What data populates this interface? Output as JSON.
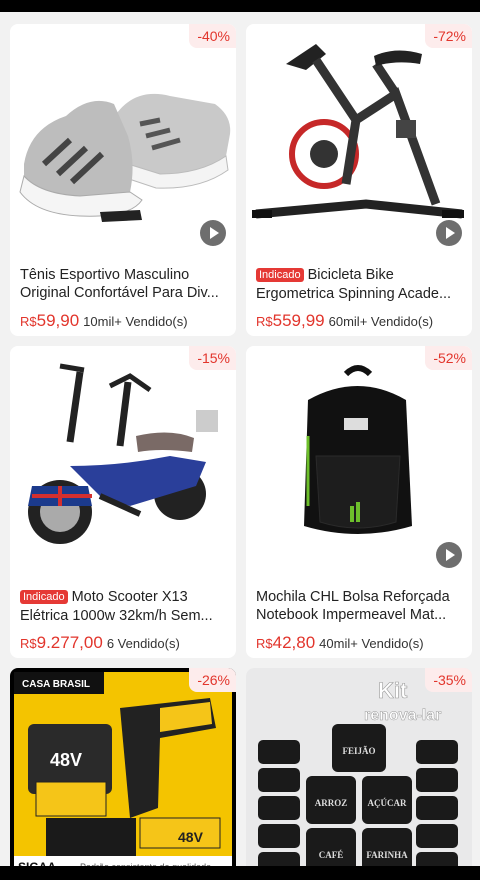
{
  "products": [
    {
      "title": "Tênis Esportivo Masculino Original Confortável Para Div...",
      "currency": "R$",
      "price": "59,90",
      "sold": "10mil+ Vendido(s)",
      "discount": "-40%",
      "tag": "",
      "video": true
    },
    {
      "title": "Bicicleta Bike Ergometrica Spinning Acade...",
      "currency": "R$",
      "price": "559,99",
      "sold": "60mil+ Vendido(s)",
      "discount": "-72%",
      "tag": "Indicado",
      "video": true
    },
    {
      "title": "Moto Scooter X13 Elétrica 1000w 32km/h Sem...",
      "currency": "R$",
      "price": "9.277,00",
      "sold": "6 Vendido(s)",
      "discount": "-15%",
      "tag": "Indicado",
      "video": false
    },
    {
      "title": "Mochila CHL Bolsa Reforçada Notebook Impermeavel Mat...",
      "currency": "R$",
      "price": "42,80",
      "sold": "40mil+ Vendido(s)",
      "discount": "-52%",
      "tag": "",
      "video": true
    },
    {
      "title": "",
      "currency": "",
      "price": "",
      "sold": "",
      "discount": "-26%",
      "tag": "",
      "video": false
    },
    {
      "title": "",
      "currency": "",
      "price": "",
      "sold": "",
      "discount": "-35%",
      "tag": "",
      "video": false
    }
  ],
  "image_texts": {
    "drill_brand": "CASA BRASIL",
    "drill_volt": "48V",
    "drill_volt2": "48V",
    "drill_footer": "SIGAA",
    "drill_footer2": "Padrão consistente de qualidade",
    "kit_title": "Kit",
    "kit_sub": "renova-lar",
    "jar_labels": [
      "FEIJÃO",
      "ARROZ",
      "AÇÚCAR",
      "CAFÉ",
      "FARINHA"
    ]
  },
  "colors": {
    "price": "#e2352c",
    "tag_bg": "#e53935",
    "badge_bg": "#fdecec"
  }
}
